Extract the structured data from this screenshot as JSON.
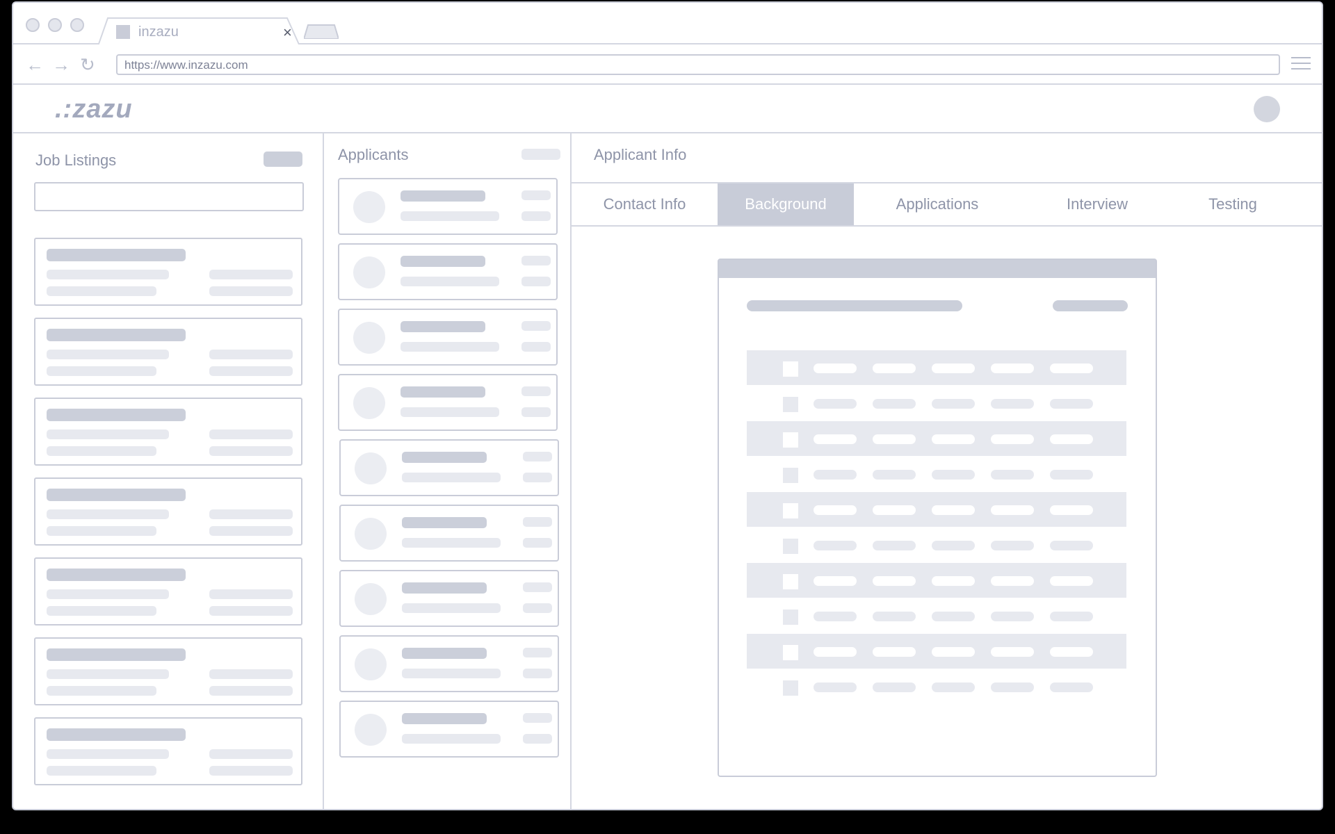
{
  "browser": {
    "tab_title": "inzazu",
    "url": "https://www.inzazu.com"
  },
  "app": {
    "logo": ".:zazu"
  },
  "jobs": {
    "title": "Job Listings"
  },
  "applicants": {
    "title": "Applicants"
  },
  "info": {
    "title": "Applicant Info",
    "tabs": [
      "Contact Info",
      "Background",
      "Applications",
      "Interview",
      "Testing"
    ],
    "active_tab": "Background"
  },
  "icons": {
    "back": "arrow-left-icon",
    "forward": "arrow-right-icon",
    "reload": "reload-icon",
    "menu": "hamburger-menu-icon",
    "close": "close-icon"
  }
}
